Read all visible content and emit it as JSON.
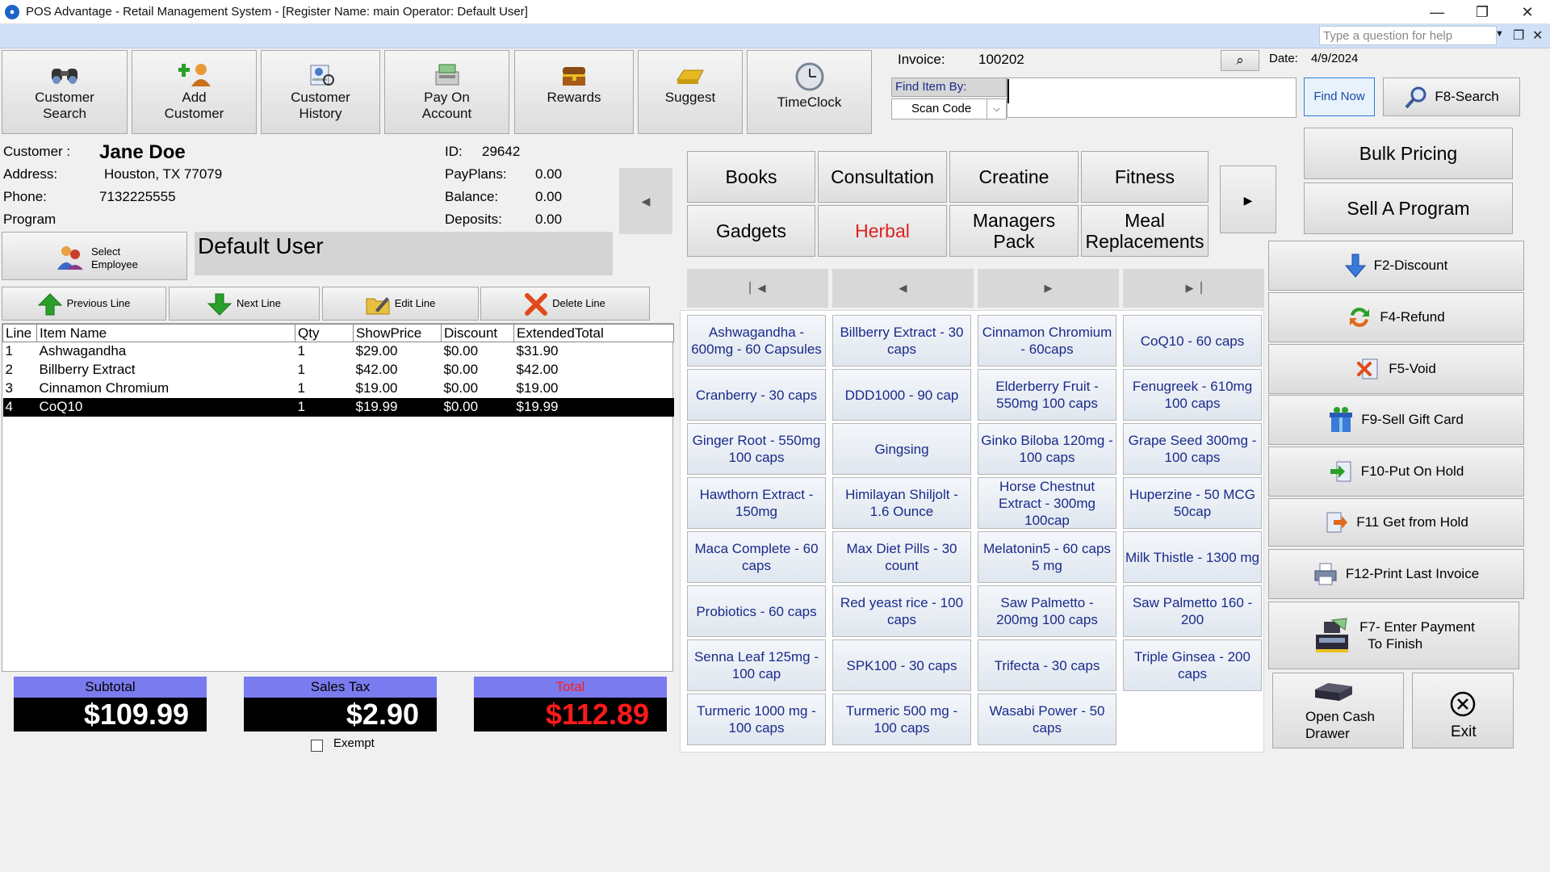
{
  "window": {
    "title": "POS Advantage - Retail Management System - [Register Name: main Operator: Default User]",
    "minimize": "—",
    "maximize": "❐",
    "close": "✕"
  },
  "help": {
    "placeholder": "Type a question for help",
    "dropdown": "▼",
    "restore": "❐",
    "close": "✕"
  },
  "toolbar": [
    {
      "line1": "Customer",
      "line2": "Search",
      "icon": "binoculars-icon"
    },
    {
      "line1": "Add",
      "line2": "Customer",
      "icon": "add-customer-icon"
    },
    {
      "line1": "Customer",
      "line2": "History",
      "icon": "customer-history-icon"
    },
    {
      "line1": "Pay On",
      "line2": "Account",
      "icon": "pay-account-icon"
    },
    {
      "line1": "Rewards",
      "line2": "",
      "icon": "treasure-chest-icon"
    },
    {
      "line1": "Suggest",
      "line2": "",
      "icon": "gold-bar-icon"
    },
    {
      "line1": "TimeClock",
      "line2": "",
      "icon": "clock-icon"
    }
  ],
  "invoice": {
    "label": "Invoice:",
    "number": "100202",
    "date_label": "Date:",
    "date": "4/9/2024",
    "find_by_label": "Find Item By:",
    "find_by_value": "Scan Code",
    "find_now": "Find Now",
    "f8_search": "F8-Search"
  },
  "customer": {
    "customer_label": "Customer :",
    "name": "Jane Doe",
    "address_label": "Address:",
    "address": "Houston, TX 77079",
    "phone_label": "Phone:",
    "phone": "7132225555",
    "program_label": "Program",
    "id_label": "ID:",
    "id": "29642",
    "payplans_label": "PayPlans:",
    "payplans": "0.00",
    "balance_label": "Balance:",
    "balance": "0.00",
    "deposits_label": "Deposits:",
    "deposits": "0.00"
  },
  "employee": {
    "select_line1": "Select",
    "select_line2": "Employee",
    "current": "Default User"
  },
  "line_buttons": {
    "previous": "Previous Line",
    "next": "Next Line",
    "edit": "Edit Line",
    "delete": "Delete Line"
  },
  "grid": {
    "headers": [
      "Line",
      "Item Name",
      "Qty",
      "ShowPrice",
      "Discount",
      "ExtendedTotal"
    ],
    "rows": [
      [
        "1",
        "Ashwagandha",
        "1",
        "$29.00",
        "$0.00",
        "$31.90"
      ],
      [
        "2",
        "Billberry Extract",
        "1",
        "$42.00",
        "$0.00",
        "$42.00"
      ],
      [
        "3",
        "Cinnamon Chromium",
        "1",
        "$19.00",
        "$0.00",
        "$19.00"
      ],
      [
        "4",
        "CoQ10",
        "1",
        "$19.99",
        "$0.00",
        "$19.99"
      ]
    ],
    "selected_row": 3
  },
  "totals": {
    "subtotal_label": "Subtotal",
    "subtotal": "$109.99",
    "tax_label": "Sales Tax",
    "tax": "$2.90",
    "total_label": "Total",
    "total": "$112.89",
    "exempt_label": "Exempt",
    "colors": {
      "header": "#7b7bf0",
      "total_text": "#ff1a1a"
    }
  },
  "categories": [
    [
      "Books",
      "Consultation",
      "Creatine",
      "Fitness"
    ],
    [
      "Gadgets",
      "Herbal",
      "Managers Pack",
      "Meal Replacements"
    ]
  ],
  "active_category": "Herbal",
  "active_category_color": "#e02020",
  "products": [
    [
      "Ashwagandha - 600mg - 60 Capsules",
      "Billberry Extract - 30 caps",
      "Cinnamon Chromium - 60caps",
      "CoQ10 - 60 caps"
    ],
    [
      "Cranberry - 30 caps",
      "DDD1000 - 90 cap",
      "Elderberry Fruit - 550mg 100 caps",
      "Fenugreek - 610mg 100 caps"
    ],
    [
      "Ginger Root - 550mg 100 caps",
      "Gingsing",
      "Ginko Biloba 120mg - 100 caps",
      "Grape Seed 300mg - 100 caps"
    ],
    [
      "Hawthorn Extract - 150mg",
      "Himilayan Shiljolt - 1.6 Ounce",
      "Horse Chestnut Extract - 300mg 100cap",
      "Huperzine - 50 MCG 50cap"
    ],
    [
      "Maca Complete - 60 caps",
      "Max Diet Pills - 30 count",
      "Melatonin5 - 60 caps 5 mg",
      "Milk Thistle - 1300 mg"
    ],
    [
      "Probiotics - 60 caps",
      "Red yeast rice - 100 caps",
      "Saw Palmetto - 200mg 100 caps",
      "Saw Palmetto 160 - 200"
    ],
    [
      "Senna Leaf 125mg - 100 cap",
      "SPK100 - 30 caps",
      "Trifecta - 30 caps",
      "Triple Ginsea - 200 caps"
    ],
    [
      "Turmeric 1000 mg - 100 caps",
      "Turmeric 500 mg - 100 caps",
      "Wasabi Power - 50 caps",
      ""
    ]
  ],
  "right_buttons": {
    "bulk_pricing": "Bulk Pricing",
    "sell_program": "Sell A Program",
    "f2": "F2-Discount",
    "f4": "F4-Refund",
    "f5": "F5-Void",
    "f9": "F9-Sell Gift Card",
    "f10": "F10-Put On Hold",
    "f11": "F11 Get from Hold",
    "f12": "F12-Print Last Invoice",
    "f7_line1": "F7- Enter Payment",
    "f7_line2": "To Finish",
    "cash_line1": "Open Cash",
    "cash_line2": "Drawer",
    "exit": "Exit"
  }
}
